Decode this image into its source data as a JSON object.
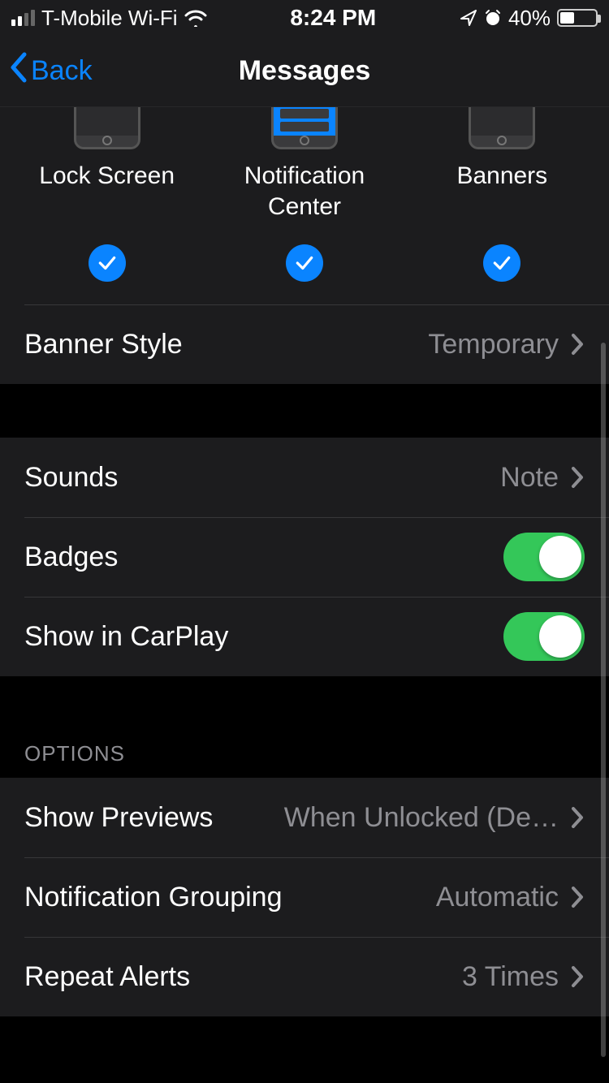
{
  "status": {
    "carrier": "T-Mobile Wi-Fi",
    "time": "8:24 PM",
    "battery_pct": "40%"
  },
  "nav": {
    "back_label": "Back",
    "title": "Messages"
  },
  "alert_styles": {
    "lock_screen": "Lock Screen",
    "notification_center": "Notification Center",
    "banners": "Banners",
    "lock_screen_checked": true,
    "notification_center_checked": true,
    "banners_checked": true
  },
  "rows": {
    "banner_style": {
      "label": "Banner Style",
      "value": "Temporary"
    },
    "sounds": {
      "label": "Sounds",
      "value": "Note"
    },
    "badges": {
      "label": "Badges",
      "on": true
    },
    "carplay": {
      "label": "Show in CarPlay",
      "on": true
    }
  },
  "options_header": "OPTIONS",
  "options": {
    "show_previews": {
      "label": "Show Previews",
      "value": "When Unlocked (De…"
    },
    "notification_grouping": {
      "label": "Notification Grouping",
      "value": "Automatic"
    },
    "repeat_alerts": {
      "label": "Repeat Alerts",
      "value": "3 Times"
    }
  }
}
